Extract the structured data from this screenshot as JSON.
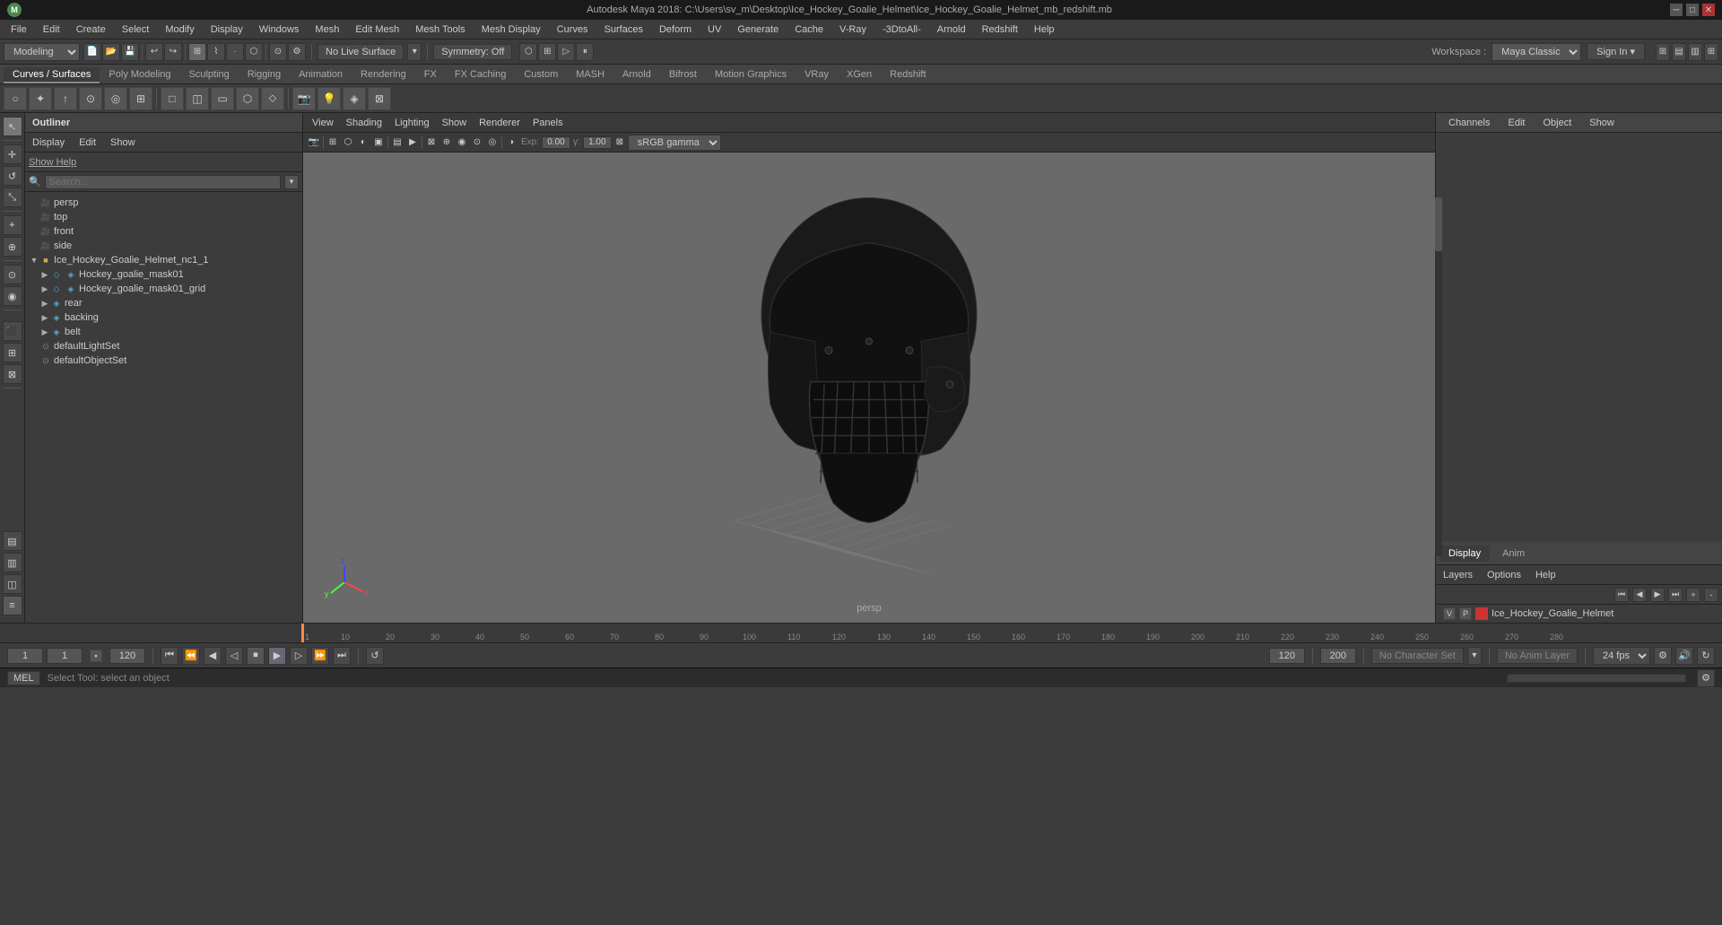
{
  "window": {
    "title": "Autodesk Maya 2018: C:\\Users\\sv_m\\Desktop\\Ice_Hockey_Goalie_Helmet\\Ice_Hockey_Goalie_Helmet_mb_redshift.mb"
  },
  "menu_bar": {
    "items": [
      "File",
      "Edit",
      "Create",
      "Select",
      "Modify",
      "Display",
      "Windows",
      "Mesh",
      "Edit Mesh",
      "Mesh Tools",
      "Mesh Display",
      "Curves",
      "Surfaces",
      "Deform",
      "UV",
      "Generate",
      "Cache",
      "V-Ray",
      "-3DtoAll-",
      "Arnold",
      "Redshift",
      "Help"
    ]
  },
  "mode_bar": {
    "mode": "Modeling",
    "no_live_surface": "No Live Surface",
    "symmetry": "Symmetry: Off",
    "workspace_label": "Workspace :",
    "workspace": "Maya Classic",
    "sign_in": "Sign In ▾"
  },
  "shelf": {
    "tabs": [
      "Curves / Surfaces",
      "Poly Modeling",
      "Sculpting",
      "Rigging",
      "Animation",
      "Rendering",
      "FX",
      "FX Caching",
      "Custom",
      "MASH",
      "Arnold",
      "Bifrost",
      "Motion Graphics",
      "VRay",
      "XGen",
      "Redshift"
    ]
  },
  "outliner": {
    "title": "Outliner",
    "menu": [
      "Display",
      "Edit",
      "Show"
    ],
    "help_label": "Show Help",
    "search_placeholder": "Search...",
    "tree": [
      {
        "id": "persp",
        "label": "persp",
        "indent": 0,
        "type": "camera",
        "arrow": false
      },
      {
        "id": "top",
        "label": "top",
        "indent": 0,
        "type": "camera",
        "arrow": false
      },
      {
        "id": "front",
        "label": "front",
        "indent": 0,
        "type": "camera",
        "arrow": false
      },
      {
        "id": "side",
        "label": "side",
        "indent": 0,
        "type": "camera",
        "arrow": false
      },
      {
        "id": "helmet_grp",
        "label": "Ice_Hockey_Goalie_Helmet_nc1_1",
        "indent": 0,
        "type": "folder",
        "arrow": true,
        "expanded": true
      },
      {
        "id": "mask01",
        "label": "Hockey_goalie_mask01",
        "indent": 1,
        "type": "mesh",
        "arrow": true,
        "expanded": true
      },
      {
        "id": "mask01_grid",
        "label": "Hockey_goalie_mask01_grid",
        "indent": 1,
        "type": "mesh",
        "arrow": true,
        "expanded": false
      },
      {
        "id": "rear",
        "label": "rear",
        "indent": 1,
        "type": "mesh",
        "arrow": true,
        "expanded": false
      },
      {
        "id": "backing",
        "label": "backing",
        "indent": 1,
        "type": "mesh",
        "arrow": true,
        "expanded": false
      },
      {
        "id": "belt",
        "label": "belt",
        "indent": 1,
        "type": "mesh",
        "arrow": true,
        "expanded": false
      },
      {
        "id": "defaultLightSet",
        "label": "defaultLightSet",
        "indent": 0,
        "type": "set",
        "arrow": false
      },
      {
        "id": "defaultObjectSet",
        "label": "defaultObjectSet",
        "indent": 0,
        "type": "set",
        "arrow": false
      }
    ]
  },
  "viewport": {
    "menu": [
      "View",
      "Shading",
      "Lighting",
      "Show",
      "Renderer",
      "Panels"
    ],
    "camera": "persp",
    "gamma": "sRGB gamma",
    "exposure": "0.00",
    "gamma_val": "1.00"
  },
  "channel_box": {
    "tabs": [
      "Channels",
      "Edit",
      "Object",
      "Show"
    ],
    "display_anim": [
      "Display",
      "Anim"
    ],
    "layers_menu": [
      "Layers",
      "Options",
      "Help"
    ],
    "layer_name": "Ice_Hockey_Goalie_Helmet",
    "layer_vp1": "V",
    "layer_vp2": "P"
  },
  "timeline": {
    "start": "1",
    "end": "120",
    "range_start": "1",
    "range_end": "200",
    "ticks": [
      "1",
      "10",
      "20",
      "30",
      "40",
      "50",
      "60",
      "70",
      "80",
      "90",
      "100",
      "110",
      "120",
      "130",
      "140",
      "150",
      "160",
      "170",
      "180",
      "190",
      "200",
      "210",
      "220",
      "230",
      "240",
      "250",
      "260",
      "270",
      "280"
    ]
  },
  "playback": {
    "current_frame": "1",
    "range_start": "1",
    "anim_end": "120",
    "range_end": "200",
    "no_character": "No Character Set",
    "no_anim_layer": "No Anim Layer",
    "fps": "24 fps"
  },
  "status_bar": {
    "language": "MEL",
    "message": "Select Tool: select an object"
  }
}
